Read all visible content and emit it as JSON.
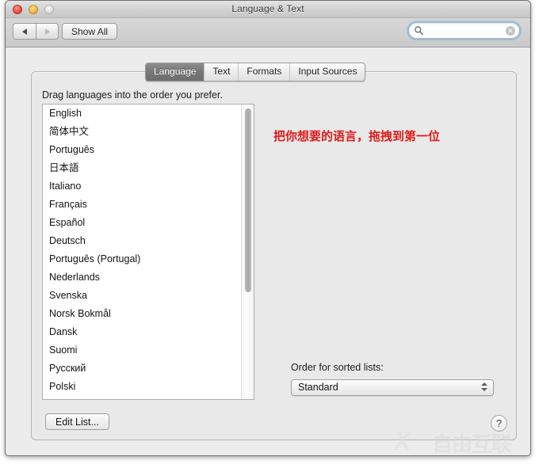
{
  "window": {
    "title": "Language & Text",
    "traffic_lights": {
      "close": "close-button",
      "minimize": "minimize-button",
      "zoom": "zoom-button"
    }
  },
  "toolbar": {
    "back_label": "◀",
    "forward_label": "▶",
    "show_all_label": "Show All",
    "search": {
      "value": "",
      "placeholder": "",
      "icon": "search-icon",
      "clear_label": "✕"
    }
  },
  "tabs": [
    {
      "label": "Language",
      "active": true
    },
    {
      "label": "Text",
      "active": false
    },
    {
      "label": "Formats",
      "active": false
    },
    {
      "label": "Input Sources",
      "active": false
    }
  ],
  "main": {
    "drag_hint": "Drag languages into the order you prefer.",
    "languages": [
      "English",
      "简体中文",
      "Português",
      "日本語",
      "Italiano",
      "Français",
      "Español",
      "Deutsch",
      "Português (Portugal)",
      "Nederlands",
      "Svenska",
      "Norsk Bokmål",
      "Dansk",
      "Suomi",
      "Русский",
      "Polski"
    ],
    "annotation": "把你想要的语言，拖拽到第一位",
    "annotation_color": "#e01b1b",
    "sorted_lists_label": "Order for sorted lists:",
    "sorted_lists_value": "Standard",
    "edit_list_label": "Edit List...",
    "help_label": "?"
  },
  "watermark": {
    "logo": "X",
    "text": "自由互联"
  }
}
